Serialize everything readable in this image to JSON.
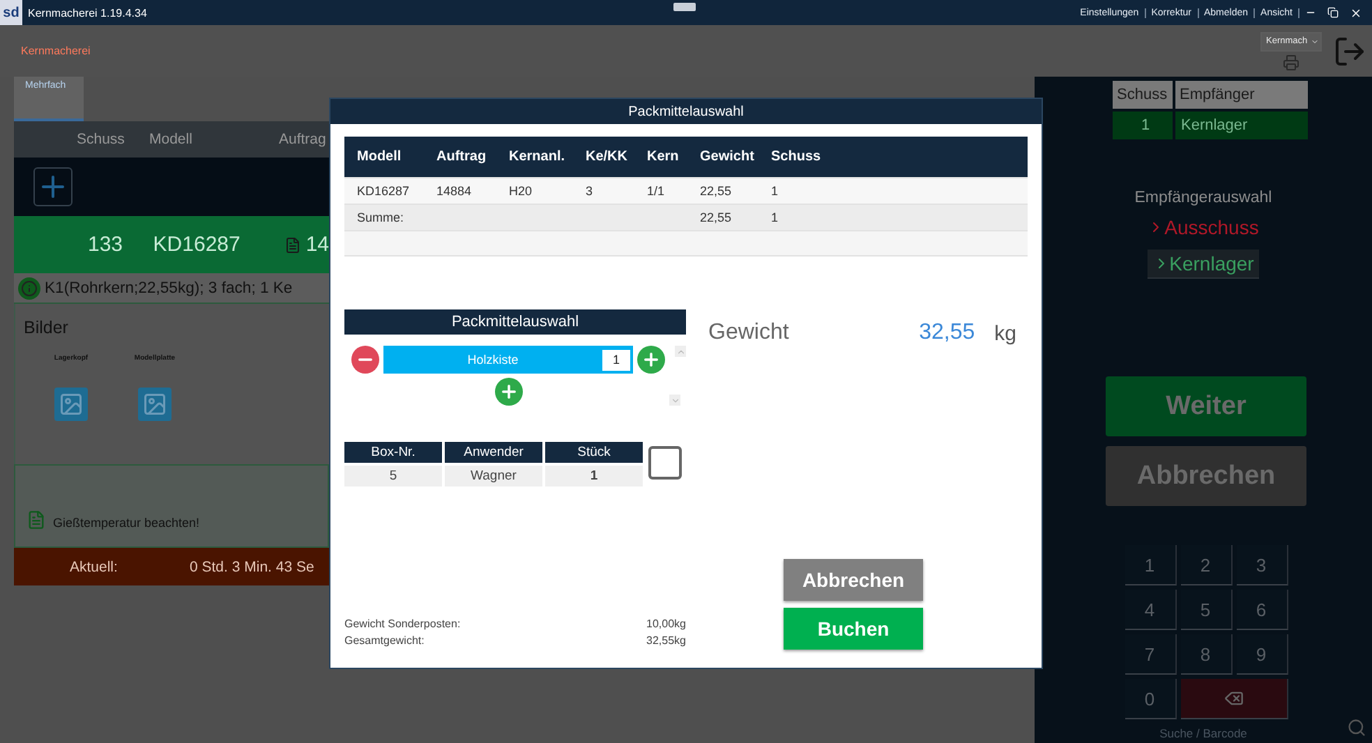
{
  "window": {
    "logo": "sd",
    "title": "Kernmacherei 1.19.4.34",
    "menu": [
      "Einstellungen",
      "Korrektur",
      "Abmelden",
      "Ansicht"
    ]
  },
  "header": {
    "title": "Kernmacherei",
    "dropdown": "Kernmach"
  },
  "tabs": [
    {
      "label": "Mehrfach",
      "selected": true
    }
  ],
  "job_table": {
    "columns": [
      "Schuss",
      "Modell",
      "Auftrag"
    ],
    "row": [
      "133",
      "KD16287",
      "14"
    ]
  },
  "info": "K1(Rohrkern;22,55kg); 3 fach; 1 Ke",
  "images": {
    "title": "Bilder",
    "items": [
      "Lagerkopf",
      "Modellplatte"
    ]
  },
  "note": "Gießtemperatur beachten!",
  "timer": {
    "label": "Aktuell:",
    "value": "0 Std. 3 Min. 43 Se"
  },
  "dialog": {
    "title": "Packmittelauswahl",
    "table": {
      "columns": [
        "Modell",
        "Auftrag",
        "Kernanl.",
        "Ke/KK",
        "Kern",
        "Gewicht",
        "Schuss"
      ],
      "rows": [
        [
          "KD16287",
          "14884",
          "H20",
          "3",
          "1/1",
          "22,55",
          "1"
        ]
      ],
      "summary": {
        "label": "Summe:",
        "weight": "22,55",
        "shots": "1"
      }
    },
    "packaging": {
      "title": "Packmittelauswahl",
      "items": [
        {
          "name": "Holzkiste",
          "quantity": "1"
        }
      ]
    },
    "boxes": {
      "columns": [
        "Box-Nr.",
        "Anwender",
        "Stück"
      ],
      "rows": [
        [
          "5",
          "Wagner",
          "1"
        ]
      ],
      "checked": false
    },
    "weight": {
      "label": "Gewicht",
      "value": "32,55",
      "unit": "kg"
    },
    "totals": [
      {
        "label": "Gewicht Sonderposten:",
        "value": "10,00kg"
      },
      {
        "label": "Gesamtgewicht:",
        "value": "32,55kg"
      }
    ],
    "buttons": [
      {
        "label": "Abbrechen",
        "kind": "cancel"
      },
      {
        "label": "Buchen",
        "kind": "confirm"
      }
    ]
  },
  "side": {
    "recipient_table": {
      "columns": [
        "Schuss",
        "Empfänger"
      ],
      "rows": [
        [
          "1",
          "Kernlager"
        ]
      ]
    },
    "recipient_choice": {
      "title": "Empfängerauswahl",
      "options": [
        {
          "label": "Ausschuss",
          "color": "#b01828",
          "selected": false
        },
        {
          "label": "Kernlager",
          "color": "#3aa060",
          "selected": true
        }
      ]
    },
    "buttons": [
      {
        "label": "Weiter",
        "kind": "confirm"
      },
      {
        "label": "Abbrechen",
        "kind": "cancel"
      }
    ],
    "keypad": [
      "1",
      "2",
      "3",
      "4",
      "5",
      "6",
      "7",
      "8",
      "9",
      "0"
    ],
    "search": "Suche / Barcode"
  }
}
